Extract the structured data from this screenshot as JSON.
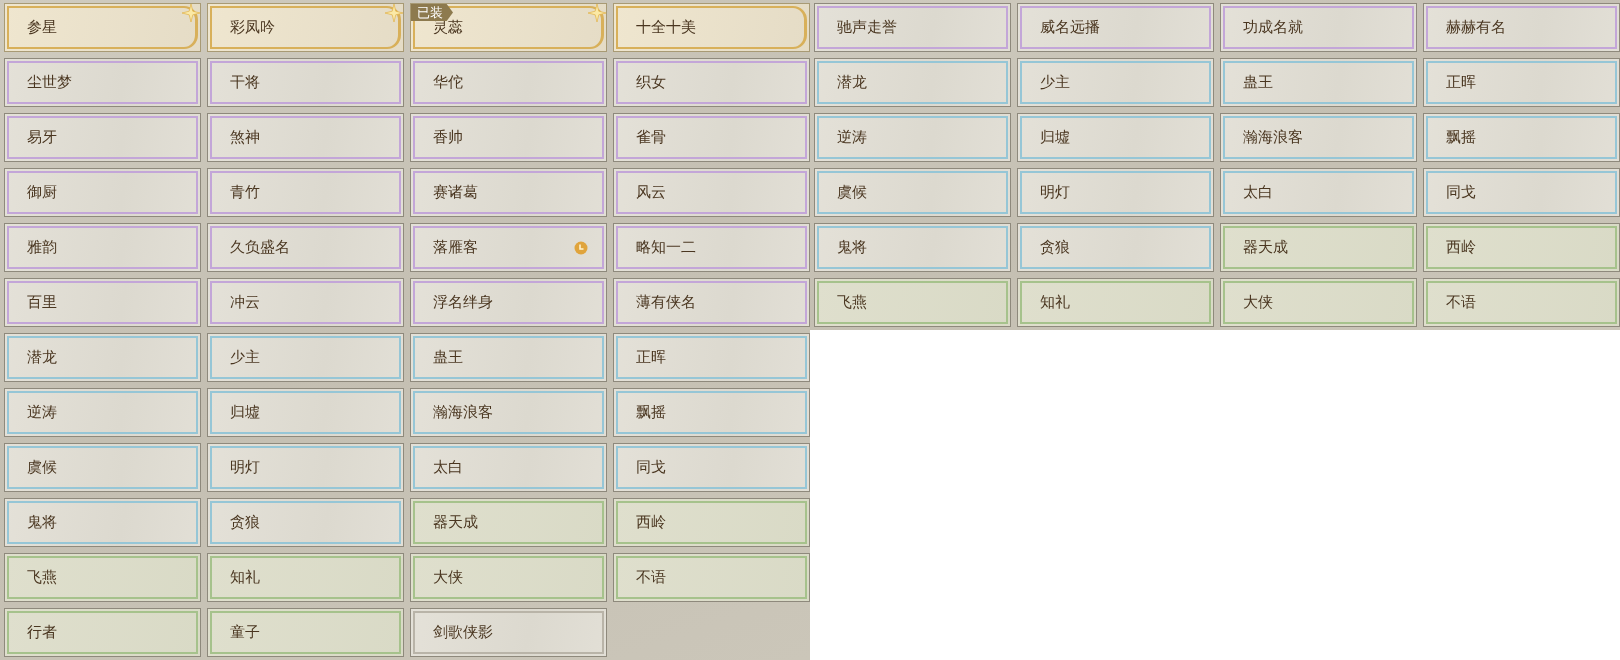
{
  "panels": [
    {
      "tiles": [
        {
          "name": "参星",
          "kind": "gold",
          "sparkle": true
        },
        {
          "name": "彩凤吟",
          "kind": "gold",
          "sparkle": true
        },
        {
          "name": "灵蕊",
          "kind": "gold",
          "sparkle": true,
          "badge": "已装"
        },
        {
          "name": "十全十美",
          "kind": "gold",
          "sparkle": false
        },
        {
          "name": "尘世梦",
          "kind": "purple"
        },
        {
          "name": "干将",
          "kind": "purple"
        },
        {
          "name": "华佗",
          "kind": "purple"
        },
        {
          "name": "织女",
          "kind": "purple"
        },
        {
          "name": "易牙",
          "kind": "purple"
        },
        {
          "name": "煞神",
          "kind": "purple"
        },
        {
          "name": "香帅",
          "kind": "purple"
        },
        {
          "name": "雀骨",
          "kind": "purple"
        },
        {
          "name": "御厨",
          "kind": "purple"
        },
        {
          "name": "青竹",
          "kind": "purple"
        },
        {
          "name": "赛诸葛",
          "kind": "purple"
        },
        {
          "name": "风云",
          "kind": "purple"
        },
        {
          "name": "雅韵",
          "kind": "purple"
        },
        {
          "name": "久负盛名",
          "kind": "purple"
        },
        {
          "name": "落雁客",
          "kind": "purple",
          "timer": true
        },
        {
          "name": "略知一二",
          "kind": "purple"
        },
        {
          "name": "百里",
          "kind": "purple"
        },
        {
          "name": "冲云",
          "kind": "purple"
        },
        {
          "name": "浮名绊身",
          "kind": "purple"
        },
        {
          "name": "薄有侠名",
          "kind": "purple"
        },
        {
          "name": "潜龙",
          "kind": "blue"
        },
        {
          "name": "少主",
          "kind": "blue"
        },
        {
          "name": "蛊王",
          "kind": "blue"
        },
        {
          "name": "正晖",
          "kind": "blue"
        },
        {
          "name": "逆涛",
          "kind": "blue"
        },
        {
          "name": "归墟",
          "kind": "blue"
        },
        {
          "name": "瀚海浪客",
          "kind": "blue"
        },
        {
          "name": "飘摇",
          "kind": "blue"
        },
        {
          "name": "虞候",
          "kind": "blue"
        },
        {
          "name": "明灯",
          "kind": "blue"
        },
        {
          "name": "太白",
          "kind": "blue"
        },
        {
          "name": "同戈",
          "kind": "blue"
        },
        {
          "name": "鬼将",
          "kind": "blue"
        },
        {
          "name": "贪狼",
          "kind": "blue"
        },
        {
          "name": "器天成",
          "kind": "green"
        },
        {
          "name": "西岭",
          "kind": "green"
        },
        {
          "name": "飞燕",
          "kind": "green"
        },
        {
          "name": "知礼",
          "kind": "green"
        },
        {
          "name": "大侠",
          "kind": "green"
        },
        {
          "name": "不语",
          "kind": "green"
        },
        {
          "name": "行者",
          "kind": "green"
        },
        {
          "name": "童子",
          "kind": "green"
        },
        {
          "name": "剑歌侠影",
          "kind": "plain"
        }
      ]
    },
    {
      "tiles": [
        {
          "name": "驰声走誉",
          "kind": "purple"
        },
        {
          "name": "威名远播",
          "kind": "purple"
        },
        {
          "name": "功成名就",
          "kind": "purple"
        },
        {
          "name": "赫赫有名",
          "kind": "purple"
        },
        {
          "name": "潜龙",
          "kind": "blue"
        },
        {
          "name": "少主",
          "kind": "blue"
        },
        {
          "name": "蛊王",
          "kind": "blue"
        },
        {
          "name": "正晖",
          "kind": "blue"
        },
        {
          "name": "逆涛",
          "kind": "blue"
        },
        {
          "name": "归墟",
          "kind": "blue"
        },
        {
          "name": "瀚海浪客",
          "kind": "blue"
        },
        {
          "name": "飘摇",
          "kind": "blue"
        },
        {
          "name": "虞候",
          "kind": "blue"
        },
        {
          "name": "明灯",
          "kind": "blue"
        },
        {
          "name": "太白",
          "kind": "blue"
        },
        {
          "name": "同戈",
          "kind": "blue"
        },
        {
          "name": "鬼将",
          "kind": "blue"
        },
        {
          "name": "贪狼",
          "kind": "blue"
        },
        {
          "name": "器天成",
          "kind": "green"
        },
        {
          "name": "西岭",
          "kind": "green"
        },
        {
          "name": "飞燕",
          "kind": "green"
        },
        {
          "name": "知礼",
          "kind": "green"
        },
        {
          "name": "大侠",
          "kind": "green"
        },
        {
          "name": "不语",
          "kind": "green"
        }
      ]
    }
  ]
}
